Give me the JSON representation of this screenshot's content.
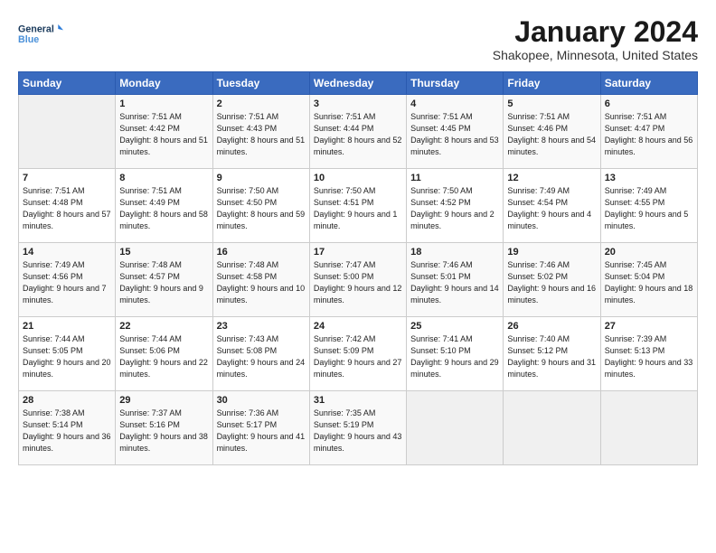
{
  "logo": {
    "line1": "General",
    "line2": "Blue"
  },
  "title": "January 2024",
  "subtitle": "Shakopee, Minnesota, United States",
  "days_of_week": [
    "Sunday",
    "Monday",
    "Tuesday",
    "Wednesday",
    "Thursday",
    "Friday",
    "Saturday"
  ],
  "weeks": [
    [
      {
        "num": "",
        "sunrise": "",
        "sunset": "",
        "daylight": ""
      },
      {
        "num": "1",
        "sunrise": "7:51 AM",
        "sunset": "4:42 PM",
        "daylight": "8 hours and 51 minutes."
      },
      {
        "num": "2",
        "sunrise": "7:51 AM",
        "sunset": "4:43 PM",
        "daylight": "8 hours and 51 minutes."
      },
      {
        "num": "3",
        "sunrise": "7:51 AM",
        "sunset": "4:44 PM",
        "daylight": "8 hours and 52 minutes."
      },
      {
        "num": "4",
        "sunrise": "7:51 AM",
        "sunset": "4:45 PM",
        "daylight": "8 hours and 53 minutes."
      },
      {
        "num": "5",
        "sunrise": "7:51 AM",
        "sunset": "4:46 PM",
        "daylight": "8 hours and 54 minutes."
      },
      {
        "num": "6",
        "sunrise": "7:51 AM",
        "sunset": "4:47 PM",
        "daylight": "8 hours and 56 minutes."
      }
    ],
    [
      {
        "num": "7",
        "sunrise": "7:51 AM",
        "sunset": "4:48 PM",
        "daylight": "8 hours and 57 minutes."
      },
      {
        "num": "8",
        "sunrise": "7:51 AM",
        "sunset": "4:49 PM",
        "daylight": "8 hours and 58 minutes."
      },
      {
        "num": "9",
        "sunrise": "7:50 AM",
        "sunset": "4:50 PM",
        "daylight": "8 hours and 59 minutes."
      },
      {
        "num": "10",
        "sunrise": "7:50 AM",
        "sunset": "4:51 PM",
        "daylight": "9 hours and 1 minute."
      },
      {
        "num": "11",
        "sunrise": "7:50 AM",
        "sunset": "4:52 PM",
        "daylight": "9 hours and 2 minutes."
      },
      {
        "num": "12",
        "sunrise": "7:49 AM",
        "sunset": "4:54 PM",
        "daylight": "9 hours and 4 minutes."
      },
      {
        "num": "13",
        "sunrise": "7:49 AM",
        "sunset": "4:55 PM",
        "daylight": "9 hours and 5 minutes."
      }
    ],
    [
      {
        "num": "14",
        "sunrise": "7:49 AM",
        "sunset": "4:56 PM",
        "daylight": "9 hours and 7 minutes."
      },
      {
        "num": "15",
        "sunrise": "7:48 AM",
        "sunset": "4:57 PM",
        "daylight": "9 hours and 9 minutes."
      },
      {
        "num": "16",
        "sunrise": "7:48 AM",
        "sunset": "4:58 PM",
        "daylight": "9 hours and 10 minutes."
      },
      {
        "num": "17",
        "sunrise": "7:47 AM",
        "sunset": "5:00 PM",
        "daylight": "9 hours and 12 minutes."
      },
      {
        "num": "18",
        "sunrise": "7:46 AM",
        "sunset": "5:01 PM",
        "daylight": "9 hours and 14 minutes."
      },
      {
        "num": "19",
        "sunrise": "7:46 AM",
        "sunset": "5:02 PM",
        "daylight": "9 hours and 16 minutes."
      },
      {
        "num": "20",
        "sunrise": "7:45 AM",
        "sunset": "5:04 PM",
        "daylight": "9 hours and 18 minutes."
      }
    ],
    [
      {
        "num": "21",
        "sunrise": "7:44 AM",
        "sunset": "5:05 PM",
        "daylight": "9 hours and 20 minutes."
      },
      {
        "num": "22",
        "sunrise": "7:44 AM",
        "sunset": "5:06 PM",
        "daylight": "9 hours and 22 minutes."
      },
      {
        "num": "23",
        "sunrise": "7:43 AM",
        "sunset": "5:08 PM",
        "daylight": "9 hours and 24 minutes."
      },
      {
        "num": "24",
        "sunrise": "7:42 AM",
        "sunset": "5:09 PM",
        "daylight": "9 hours and 27 minutes."
      },
      {
        "num": "25",
        "sunrise": "7:41 AM",
        "sunset": "5:10 PM",
        "daylight": "9 hours and 29 minutes."
      },
      {
        "num": "26",
        "sunrise": "7:40 AM",
        "sunset": "5:12 PM",
        "daylight": "9 hours and 31 minutes."
      },
      {
        "num": "27",
        "sunrise": "7:39 AM",
        "sunset": "5:13 PM",
        "daylight": "9 hours and 33 minutes."
      }
    ],
    [
      {
        "num": "28",
        "sunrise": "7:38 AM",
        "sunset": "5:14 PM",
        "daylight": "9 hours and 36 minutes."
      },
      {
        "num": "29",
        "sunrise": "7:37 AM",
        "sunset": "5:16 PM",
        "daylight": "9 hours and 38 minutes."
      },
      {
        "num": "30",
        "sunrise": "7:36 AM",
        "sunset": "5:17 PM",
        "daylight": "9 hours and 41 minutes."
      },
      {
        "num": "31",
        "sunrise": "7:35 AM",
        "sunset": "5:19 PM",
        "daylight": "9 hours and 43 minutes."
      },
      {
        "num": "",
        "sunrise": "",
        "sunset": "",
        "daylight": ""
      },
      {
        "num": "",
        "sunrise": "",
        "sunset": "",
        "daylight": ""
      },
      {
        "num": "",
        "sunrise": "",
        "sunset": "",
        "daylight": ""
      }
    ]
  ],
  "sunrise_label": "Sunrise:",
  "sunset_label": "Sunset:",
  "daylight_label": "Daylight:"
}
